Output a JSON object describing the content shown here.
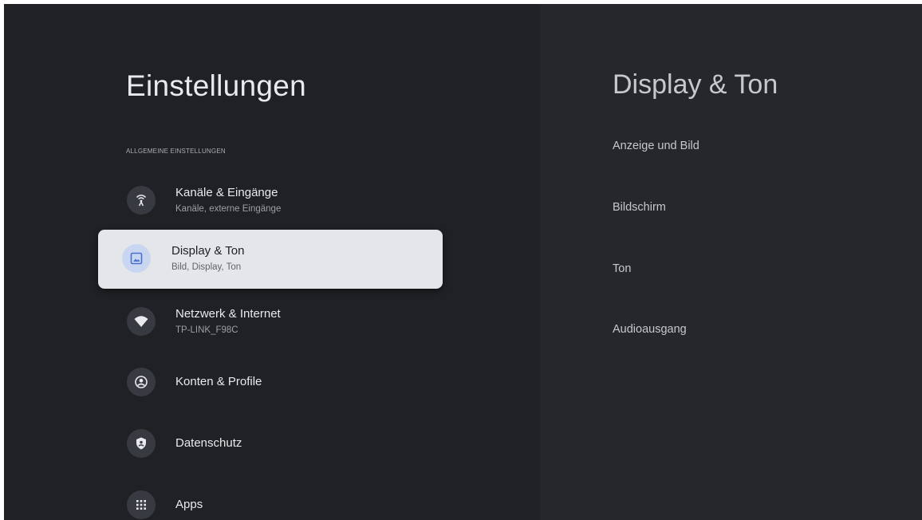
{
  "page": {
    "title": "Einstellungen"
  },
  "section": {
    "header": "ALLGEMEINE EINSTELLUNGEN"
  },
  "menu": {
    "items": [
      {
        "label": "Kanäle & Eingänge",
        "sublabel": "Kanäle, externe Eingänge",
        "icon": "antenna-icon"
      },
      {
        "label": "Display & Ton",
        "sublabel": "Bild, Display, Ton",
        "icon": "image-icon",
        "selected": true
      },
      {
        "label": "Netzwerk & Internet",
        "sublabel": "TP-LINK_F98C",
        "icon": "wifi-icon"
      },
      {
        "label": "Konten & Profile",
        "icon": "account-icon"
      },
      {
        "label": "Datenschutz",
        "icon": "shield-icon"
      },
      {
        "label": "Apps",
        "icon": "apps-grid-icon"
      }
    ]
  },
  "detail": {
    "title": "Display & Ton",
    "items": [
      {
        "label": "Anzeige und Bild"
      },
      {
        "label": "Bildschirm"
      },
      {
        "label": "Ton"
      },
      {
        "label": "Audioausgang"
      }
    ]
  },
  "colors": {
    "background": "#202125",
    "detail_background": "#25272c",
    "selected_item": "#e4e6ea",
    "selected_icon_bg": "#c9d6f2",
    "accent": "#4a72c9"
  }
}
